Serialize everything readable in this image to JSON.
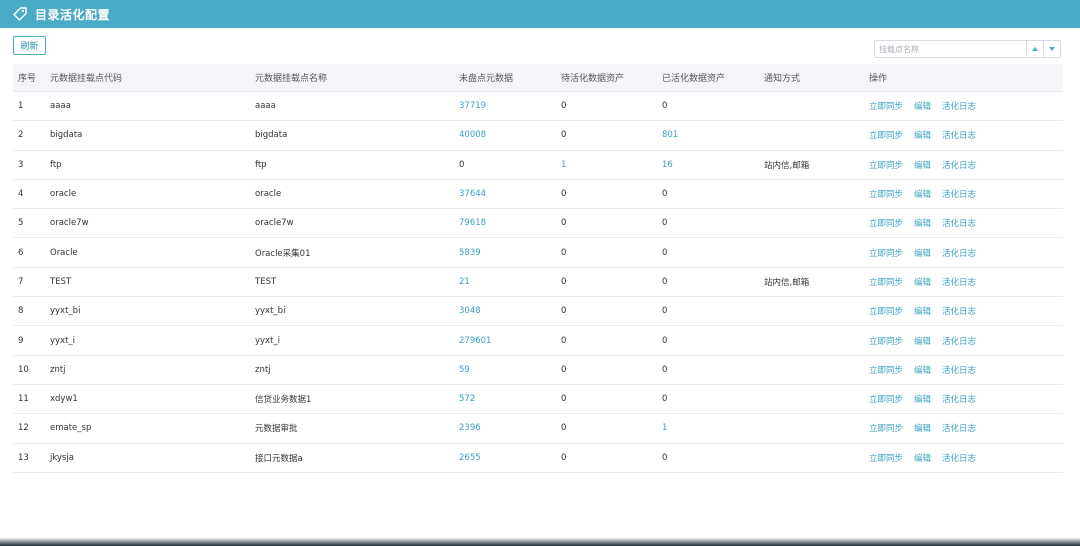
{
  "header": {
    "title": "目录活化配置",
    "icon": "tag-icon",
    "color": "#4baac4"
  },
  "toolbar": {
    "refresh_label": "刷新"
  },
  "search": {
    "placeholder": "挂载点名称",
    "value": ""
  },
  "table": {
    "columns": [
      "序号",
      "元数据挂载点代码",
      "元数据挂载点名称",
      "未盘点元数据",
      "待活化数据资产",
      "已活化数据资产",
      "通知方式",
      "操作"
    ],
    "actions": [
      "立即同步",
      "编辑",
      "活化日志"
    ],
    "rows": [
      {
        "no": "1",
        "code": "aaaa",
        "name": "aaaa",
        "uninventoried": "37719",
        "pending": "0",
        "activated": "0",
        "notify": ""
      },
      {
        "no": "2",
        "code": "bigdata",
        "name": "bigdata",
        "uninventoried": "40008",
        "pending": "0",
        "activated": "801",
        "notify": ""
      },
      {
        "no": "3",
        "code": "ftp",
        "name": "ftp",
        "uninventoried": "0",
        "pending": "1",
        "activated": "16",
        "notify": "站内信,邮箱"
      },
      {
        "no": "4",
        "code": "oracle",
        "name": "oracle",
        "uninventoried": "37644",
        "pending": "0",
        "activated": "0",
        "notify": ""
      },
      {
        "no": "5",
        "code": "oracle7w",
        "name": "oracle7w",
        "uninventoried": "79618",
        "pending": "0",
        "activated": "0",
        "notify": ""
      },
      {
        "no": "6",
        "code": "Oracle",
        "name": "Oracle采集01",
        "uninventoried": "5839",
        "pending": "0",
        "activated": "0",
        "notify": ""
      },
      {
        "no": "7",
        "code": "TEST",
        "name": "TEST",
        "uninventoried": "21",
        "pending": "0",
        "activated": "0",
        "notify": "站内信,邮箱"
      },
      {
        "no": "8",
        "code": "yyxt_bi",
        "name": "yyxt_bi",
        "uninventoried": "3048",
        "pending": "0",
        "activated": "0",
        "notify": ""
      },
      {
        "no": "9",
        "code": "yyxt_i",
        "name": "yyxt_i",
        "uninventoried": "279601",
        "pending": "0",
        "activated": "0",
        "notify": ""
      },
      {
        "no": "10",
        "code": "zntj",
        "name": "zntj",
        "uninventoried": "59",
        "pending": "0",
        "activated": "0",
        "notify": ""
      },
      {
        "no": "11",
        "code": "xdyw1",
        "name": "信贷业务数据1",
        "uninventoried": "572",
        "pending": "0",
        "activated": "0",
        "notify": ""
      },
      {
        "no": "12",
        "code": "emate_sp",
        "name": "元数据审批",
        "uninventoried": "2396",
        "pending": "0",
        "activated": "1",
        "notify": ""
      },
      {
        "no": "13",
        "code": "jkysja",
        "name": "接口元数据a",
        "uninventoried": "2655",
        "pending": "0",
        "activated": "0",
        "notify": ""
      }
    ]
  }
}
